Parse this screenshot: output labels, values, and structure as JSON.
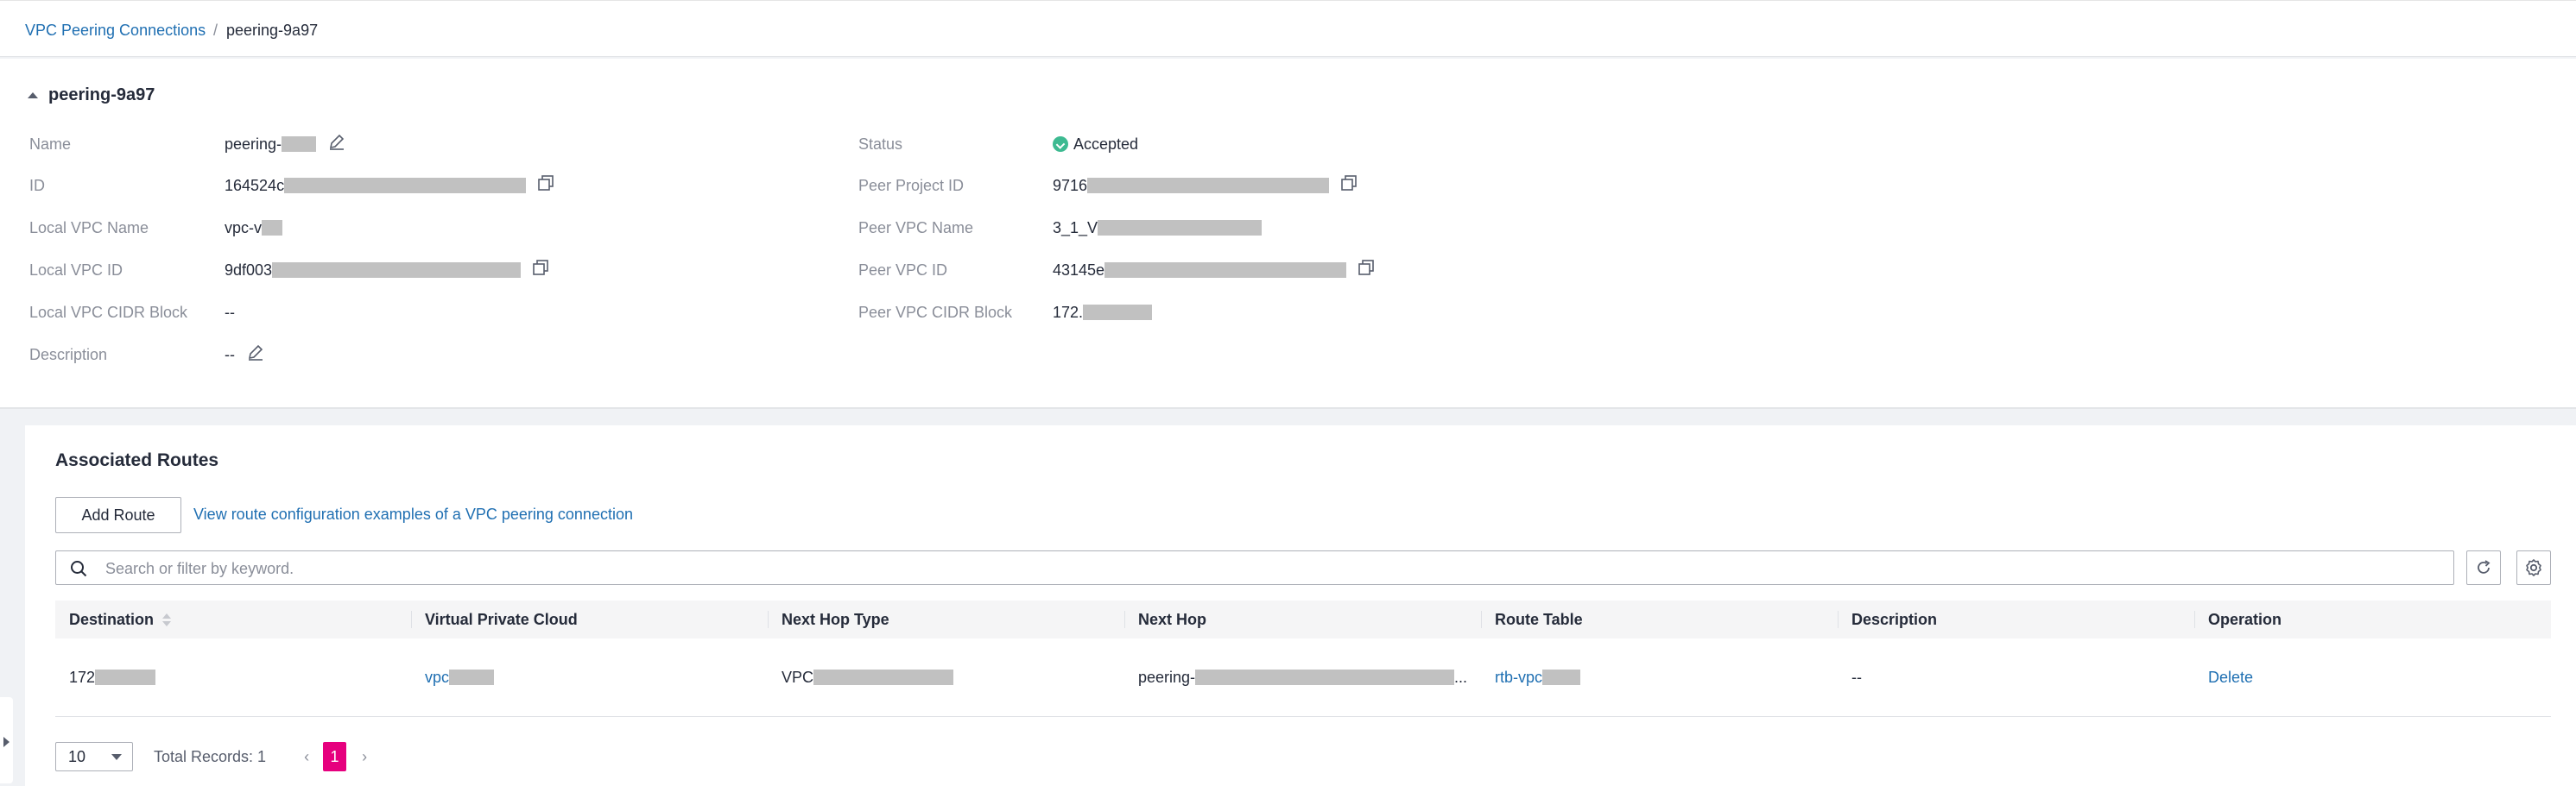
{
  "breadcrumb": {
    "parent": "VPC Peering Connections",
    "separator": "/",
    "current": "peering-9a97"
  },
  "detail": {
    "title": "peering-9a97",
    "left": [
      {
        "label": "Name",
        "value": "peering-"
      },
      {
        "label": "ID",
        "value": "164524c"
      },
      {
        "label": "Local VPC Name",
        "value": "vpc-v"
      },
      {
        "label": "Local VPC ID",
        "value": "9df003"
      },
      {
        "label": "Local VPC CIDR Block",
        "value": "--"
      },
      {
        "label": "Description",
        "value": "--"
      }
    ],
    "right": [
      {
        "label": "Status",
        "value": "Accepted"
      },
      {
        "label": "Peer Project ID",
        "value": "9716"
      },
      {
        "label": "Peer VPC Name",
        "value": "3_1_V"
      },
      {
        "label": "Peer VPC ID",
        "value": "43145e"
      },
      {
        "label": "Peer VPC CIDR Block",
        "value": "172."
      }
    ]
  },
  "routes": {
    "title": "Associated Routes",
    "add_button": "Add Route",
    "example_link": "View route configuration examples of a VPC peering connection",
    "search_placeholder": "Search or filter by keyword.",
    "columns": [
      "Destination",
      "Virtual Private Cloud",
      "Next Hop Type",
      "Next Hop",
      "Route Table",
      "Description",
      "Operation"
    ],
    "rows": [
      {
        "destination": "172",
        "vpc": "vpc",
        "next_hop_type": "VPC",
        "next_hop": "peering-",
        "next_hop_suffix": "...",
        "route_table": "rtb-vpc",
        "description": "--",
        "operation": "Delete"
      }
    ]
  },
  "pagination": {
    "page_size": "10",
    "total": "Total Records: 1",
    "current_page": "1"
  },
  "colors": {
    "link": "#1f6fb2",
    "accent_page": "#e6007e",
    "status_ok": "#3dba91"
  }
}
